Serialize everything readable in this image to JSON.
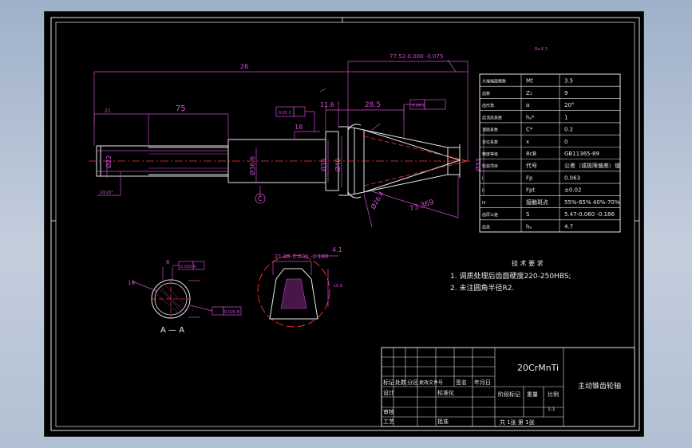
{
  "dims": {
    "d26": "26",
    "d77": "77.52-0.000\n-0.075",
    "d21": "21",
    "d75": "75",
    "d116": "11.6",
    "d285": "28.5",
    "d18": "18",
    "d16": "16",
    "d3366": "Ø36.6",
    "d35": "Ø35",
    "d40": "Ø40",
    "d22": "Ø22",
    "d33": "Ø33",
    "d73": "73.369",
    "d264": "Ø26.4",
    "d1020": "10/20°",
    "dC": "C",
    "d6": "6",
    "d18b": "18",
    "d41": "4.1",
    "d2188": "21.88-0.000\n-0.180",
    "d188": "18.8",
    "secA": "A",
    "secAA": "A — A",
    "tol1": "0.01 C",
    "tol2": "0.04 C",
    "tol3": "0.025 A",
    "tol4": "0.025 B",
    "rough": "Ra 6.3"
  },
  "params": [
    [
      "大端端面模数",
      "Mt",
      "3.5"
    ],
    [
      "齿数",
      "Z₁",
      "9"
    ],
    [
      "齿形角",
      "α",
      "20°"
    ],
    [
      "齿顶高系数",
      "hₐ*",
      "1"
    ],
    [
      "顶隙系数",
      "C*",
      "0.2"
    ],
    [
      "变位系数",
      "x",
      "0"
    ],
    [
      "精度等级",
      "8cB",
      "GB11365-89"
    ],
    [
      "检验项目",
      "代号",
      "公差（或极限偏差）值"
    ],
    [
      "I",
      "Fp",
      "0.063"
    ],
    [
      "II",
      "Fpt",
      "±0.02"
    ],
    [
      "III",
      "接触斑点",
      "55%-65% 40%-70%"
    ],
    [
      "齿厚公差",
      "S",
      "5.47-0.060 -0.186"
    ],
    [
      "齿高",
      "hₐ",
      "4.7"
    ]
  ],
  "tech": {
    "title": "技 术 要 求",
    "line1": "1. 调质处理后齿面硬度220-250HBS;",
    "line2": "2. 未注圆角半径R2."
  },
  "titleblock": {
    "material": "20CrMnTi",
    "name": "主动锥齿轮轴",
    "c1": "标记",
    "c2": "处数",
    "c3": "分区",
    "c4": "更改文件号",
    "c5": "签名",
    "c6": "年月日",
    "design": "设计",
    "std": "标准化",
    "stage": "阶段标记",
    "weight": "重量",
    "scale": "比例",
    "scaleval": "1:1",
    "review": "审核",
    "craft": "工艺",
    "approve": "批准",
    "sheet": "共 1张 第 1张"
  }
}
